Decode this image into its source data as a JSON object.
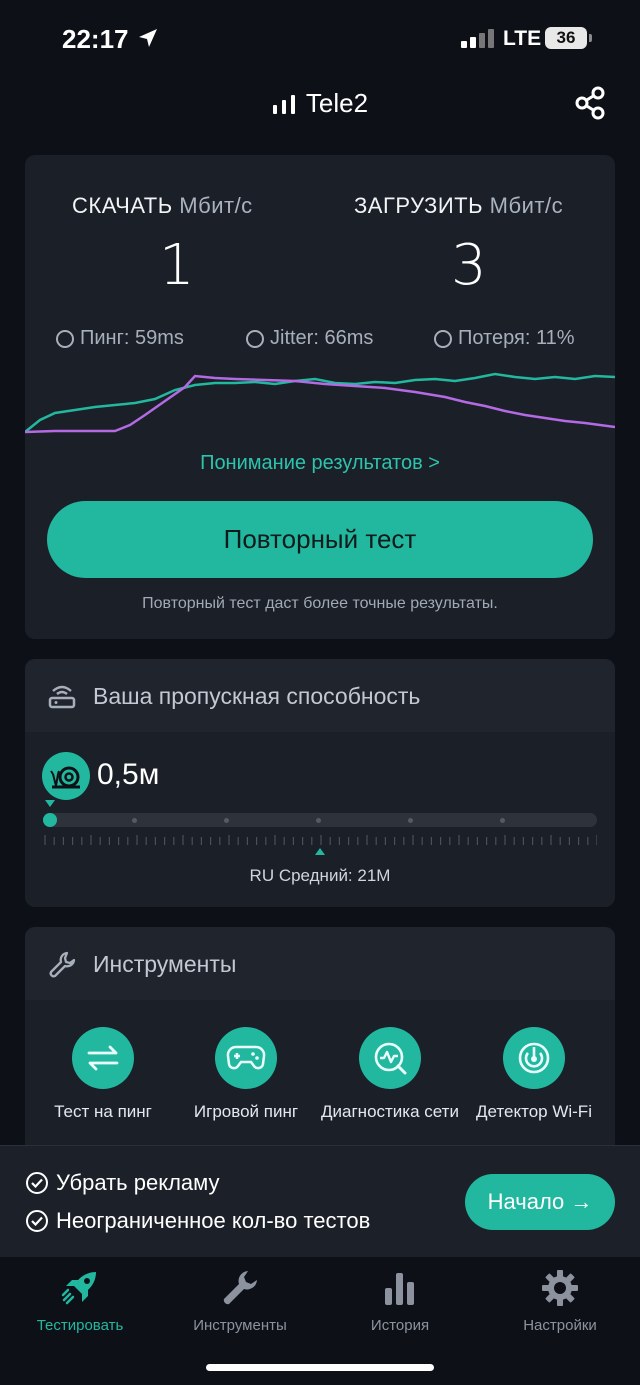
{
  "status": {
    "time": "22:17",
    "network": "LTE",
    "battery": "36"
  },
  "header": {
    "carrier": "Tele2"
  },
  "result": {
    "download_label": "СКАЧАТЬ",
    "download_unit": "Мбит/с",
    "download_value": "1",
    "upload_label": "ЗАГРУЗИТЬ",
    "upload_unit": "Мбит/с",
    "upload_value": "3",
    "ping": "Пинг: 59ms",
    "jitter": "Jitter: 66ms",
    "loss": "Потеря: 11%",
    "understand_link": "Понимание результатов >",
    "retest_button": "Повторный тест",
    "retest_note": "Повторный тест даст более точные результаты."
  },
  "bandwidth": {
    "title": "Ваша пропускная способность",
    "value": "0,5м",
    "average_label": "RU Средний: 21M"
  },
  "tools": {
    "title": "Инструменты",
    "items": [
      {
        "label": "Тест на пинг",
        "icon": "arrows-swap-icon"
      },
      {
        "label": "Игровой пинг",
        "icon": "gamepad-icon"
      },
      {
        "label": "Диагностика сети",
        "icon": "network-diagnostic-icon"
      },
      {
        "label": "Детектор Wi-Fi",
        "icon": "wifi-detector-icon"
      }
    ]
  },
  "promo": {
    "line1": "Убрать рекламу",
    "line2": "Неограниченное кол-во тестов",
    "start_button": "Начало →"
  },
  "tabbar": {
    "items": [
      {
        "label": "Тестировать",
        "icon": "rocket-icon",
        "active": true
      },
      {
        "label": "Инструменты",
        "icon": "wrench-icon",
        "active": false
      },
      {
        "label": "История",
        "icon": "bar-chart-icon",
        "active": false
      },
      {
        "label": "Настройки",
        "icon": "gear-icon",
        "active": false
      }
    ]
  },
  "colors": {
    "accent": "#22b8a0",
    "download_series": "#22b8a0",
    "upload_series": "#b36ae2",
    "background": "#0d1117",
    "card": "#1b1f27"
  }
}
